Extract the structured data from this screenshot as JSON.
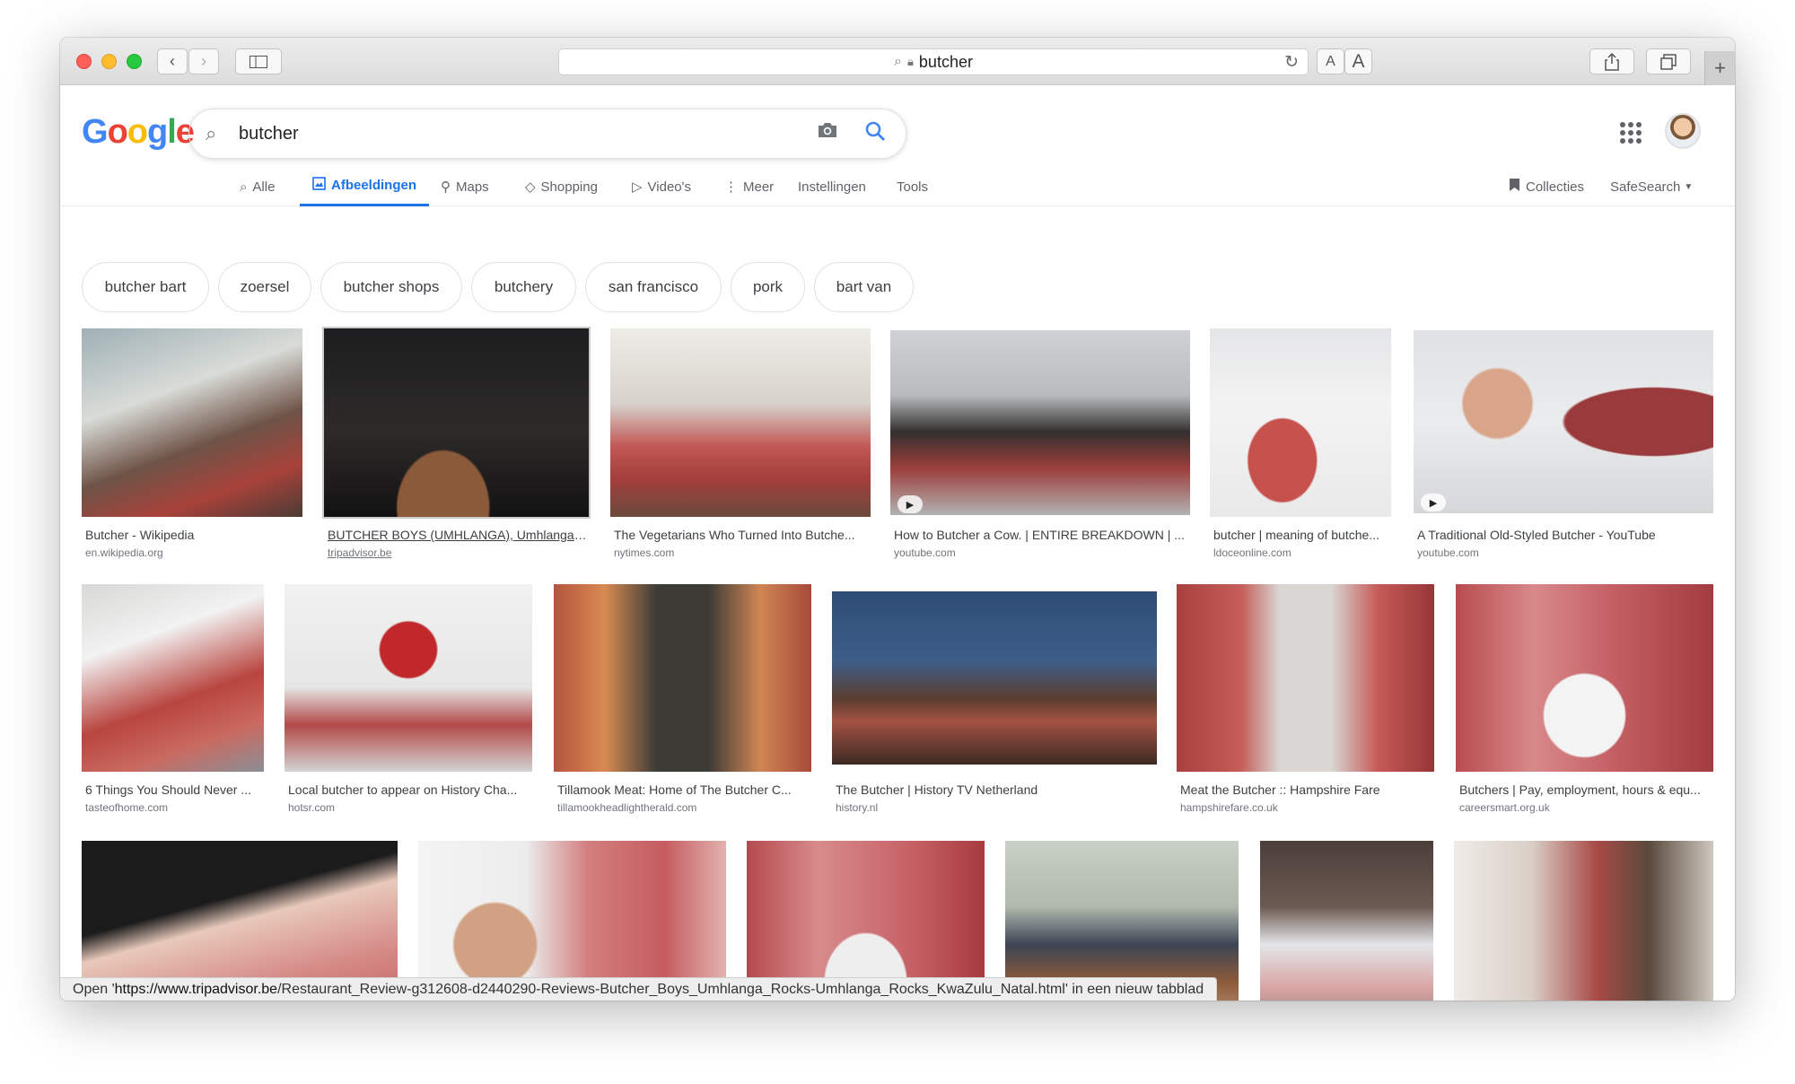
{
  "browser": {
    "url_text": "butcher",
    "text_size_small": "A",
    "text_size_large": "A",
    "new_tab": "+"
  },
  "google": {
    "logo_letters": [
      {
        "ch": "G",
        "color": "#4285F4"
      },
      {
        "ch": "o",
        "color": "#EA4335"
      },
      {
        "ch": "o",
        "color": "#FBBC05"
      },
      {
        "ch": "g",
        "color": "#4285F4"
      },
      {
        "ch": "l",
        "color": "#34A853"
      },
      {
        "ch": "e",
        "color": "#EA4335"
      }
    ],
    "query": "butcher"
  },
  "tabs": {
    "all": "Alle",
    "images": "Afbeeldingen",
    "maps": "Maps",
    "shopping": "Shopping",
    "videos": "Video's",
    "more": "Meer",
    "settings": "Instellingen",
    "tools": "Tools",
    "collections": "Collecties",
    "safesearch": "SafeSearch"
  },
  "chips": [
    "butcher bart",
    "zoersel",
    "butcher shops",
    "butchery",
    "san francisco",
    "pork",
    "bart van"
  ],
  "results": [
    {
      "title": "Butcher - Wikipedia",
      "source": "en.wikipedia.org",
      "video": false
    },
    {
      "title": "BUTCHER BOYS (UMHLANGA), Umhlanga ...",
      "source": "tripadvisor.be",
      "video": false
    },
    {
      "title": "The Vegetarians Who Turned Into Butche...",
      "source": "nytimes.com",
      "video": false
    },
    {
      "title": "How to Butcher a Cow. | ENTIRE BREAKDOWN | ...",
      "source": "youtube.com",
      "video": true
    },
    {
      "title": "butcher | meaning of butche...",
      "source": "ldoceonline.com",
      "video": false
    },
    {
      "title": "A Traditional Old-Styled Butcher - YouTube",
      "source": "youtube.com",
      "video": true
    },
    {
      "title": "6 Things You Should Never ...",
      "source": "tasteofhome.com",
      "video": false
    },
    {
      "title": "Local butcher to appear on History Cha...",
      "source": "hotsr.com",
      "video": false
    },
    {
      "title": "Tillamook Meat: Home of The Butcher C...",
      "source": "tillamookheadlightherald.com",
      "video": false
    },
    {
      "title": "The Butcher | History TV Netherland",
      "source": "history.nl",
      "video": false
    },
    {
      "title": "Meat the Butcher :: Hampshire Fare",
      "source": "hampshirefare.co.uk",
      "video": false
    },
    {
      "title": "Butchers | Pay, employment, hours & equ...",
      "source": "careersmart.org.uk",
      "video": false
    }
  ],
  "status": {
    "prefix": "Open '",
    "host": "https://www.tripadvisor.be",
    "path": "/Restaurant_Review-g312608-d2440290-Reviews-Butcher_Boys_Umhlanga_Rocks-Umhlanga_Rocks_KwaZulu_Natal.html",
    "suffix": "' in een nieuw tabblad"
  }
}
